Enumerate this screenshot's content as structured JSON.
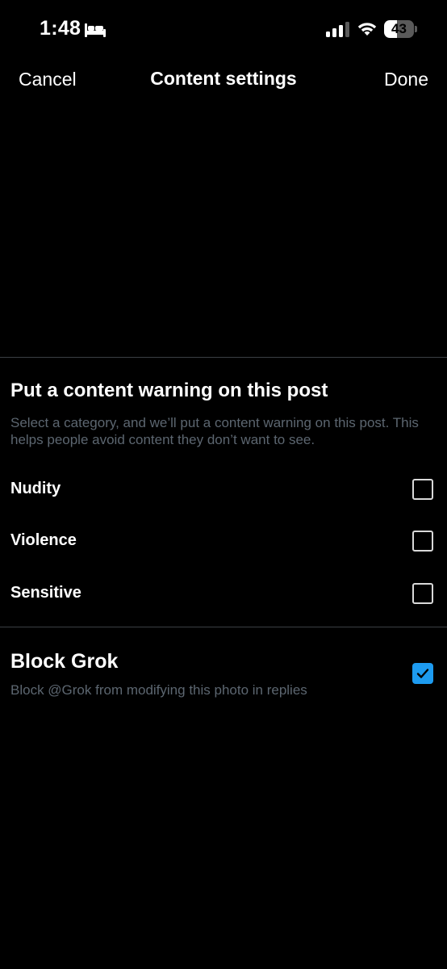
{
  "status_bar": {
    "time": "1:48",
    "sleep_icon": "bed-icon",
    "signal_icon": "cellular-signal-icon",
    "wifi_icon": "wifi-icon",
    "battery_level": "43",
    "battery_fraction": 0.43
  },
  "nav": {
    "cancel_label": "Cancel",
    "title": "Content settings",
    "done_label": "Done"
  },
  "content_warning": {
    "title": "Put a content warning on this post",
    "description": "Select a category, and we’ll put a content warning on this post. This helps people avoid content they don’t want to see.",
    "options": [
      {
        "label": "Nudity",
        "checked": false
      },
      {
        "label": "Violence",
        "checked": false
      },
      {
        "label": "Sensitive",
        "checked": false
      }
    ]
  },
  "block_grok": {
    "title": "Block Grok",
    "description": "Block @Grok from modifying this photo in replies",
    "checked": true
  },
  "colors": {
    "background": "#000000",
    "accent": "#1d9bf0",
    "secondary_text": "#5c6670",
    "divider": "#3b3f44"
  }
}
